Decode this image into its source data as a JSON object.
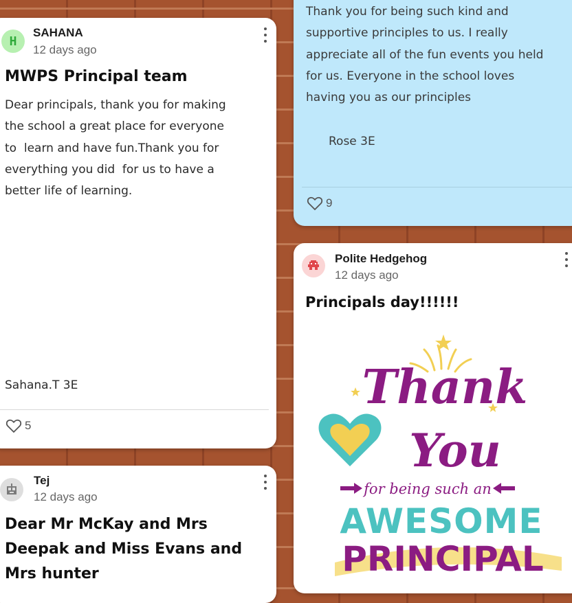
{
  "cards": {
    "sahana": {
      "avatar_letter": "H",
      "author": "SAHANA",
      "time": "12 days ago",
      "title": "MWPS Principal team",
      "body": "Dear principals, thank you for making\nthe school a great place for everyone\nto  learn and have fun.Thank you for\neverything you did  for us to have a\nbetter life of learning.",
      "signature": "Sahana.T 3E",
      "likes": "5"
    },
    "rose": {
      "body": "Thank you for being such kind and\nsupportive principles to us. I really\nappreciate all of the fun events you held\nfor us. Everyone in the school loves\nhaving you as our principles",
      "signature": "Rose 3E",
      "likes": "9"
    },
    "hedgehog": {
      "author": "Polite Hedgehog",
      "time": "12 days ago",
      "title": "Principals day!!!!!!",
      "image_text": {
        "thank": "Thank",
        "you": "You",
        "for_being": "for being such an",
        "awesome": "AWESOME",
        "principal": "PRINCIPAL"
      }
    },
    "tej": {
      "author": "Tej",
      "time": "12 days ago",
      "title_line1": "Dear Mr McKay and Mrs",
      "title_line2": "Deepak and Miss Evans and",
      "title_line3": "Mrs hunter"
    }
  },
  "colors": {
    "sahana_avatar_bg": "#b7f0b1",
    "sahana_avatar_fg": "#2faa3a",
    "hedgehog_avatar_bg": "#fbd5d5",
    "hedgehog_avatar_fg": "#e0474c",
    "tej_avatar_bg": "#dedede",
    "purple": "#8b1c82",
    "teal": "#4cc2c0",
    "yellow": "#f2cf53"
  }
}
